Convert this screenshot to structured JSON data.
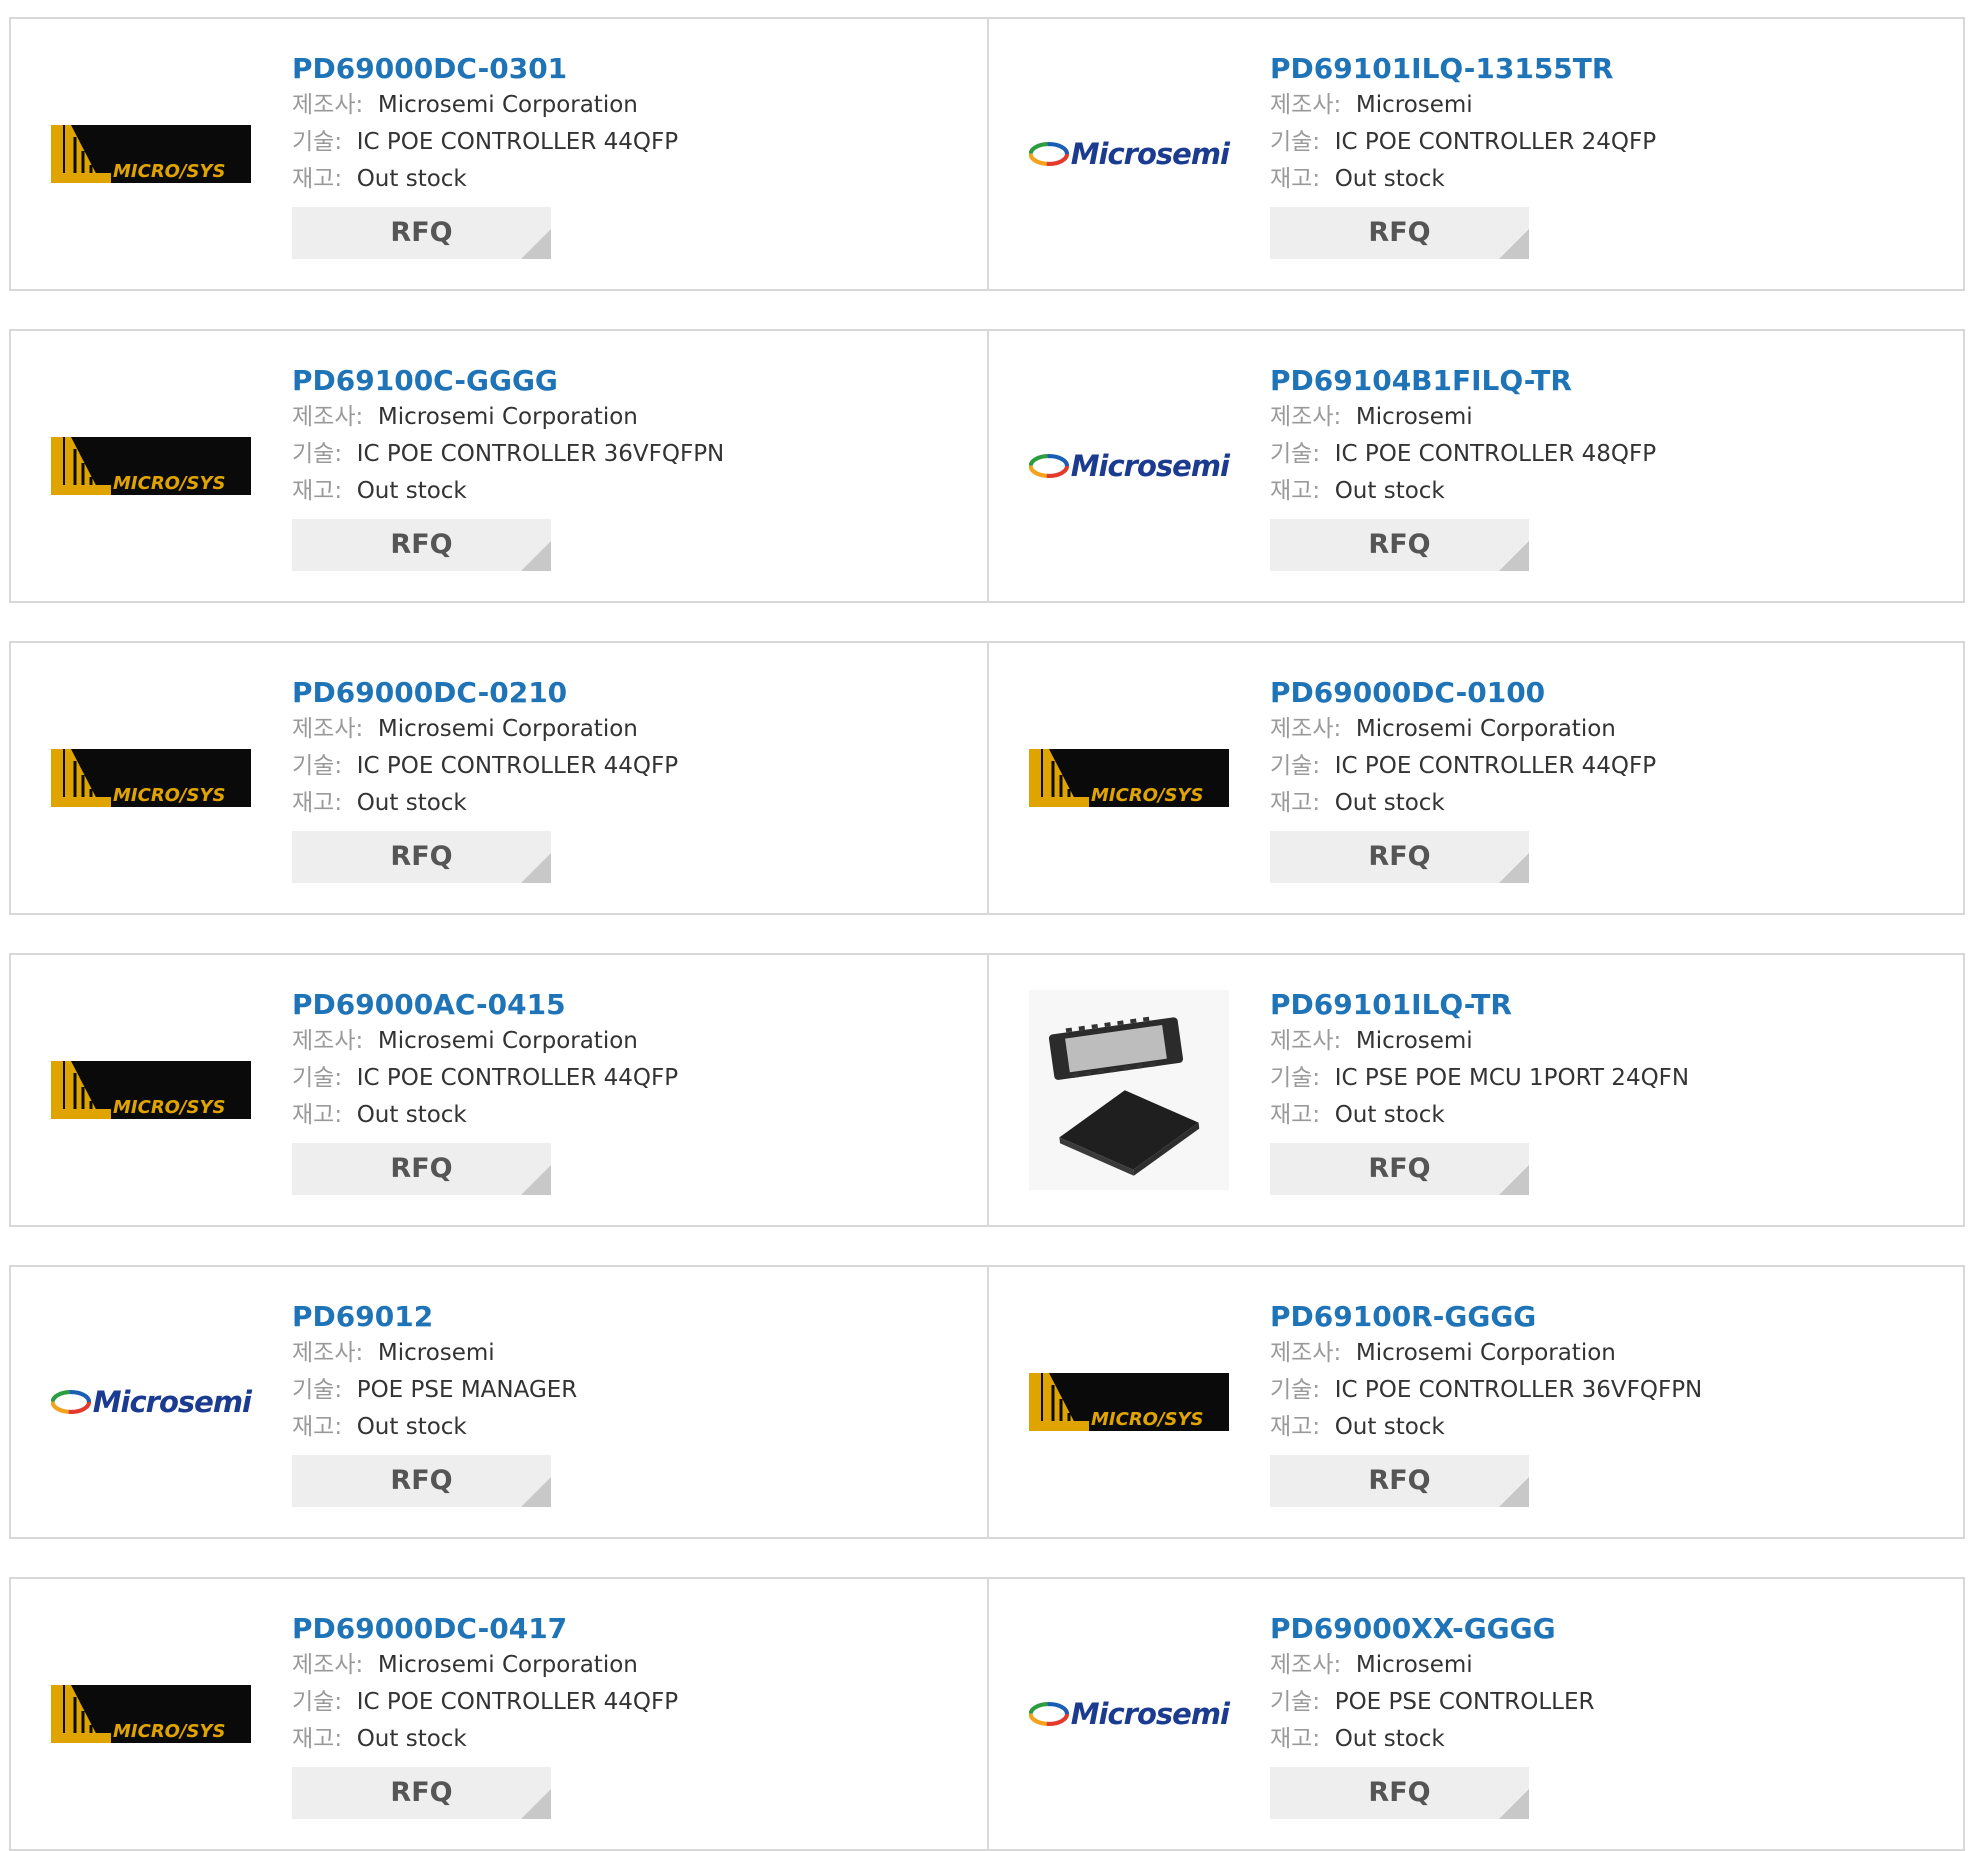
{
  "labels": {
    "manufacturer": "제조사:",
    "description": "기술:",
    "stock": "재고:",
    "rfq": "RFQ"
  },
  "logos": {
    "microsys_text": "MICRO/SYS",
    "microsemi_text": "Microsemi"
  },
  "colors": {
    "part_link": "#1f73b7",
    "label_gray": "#9a9a9a",
    "value_text": "#333333",
    "rfq_bg": "#eeeeee",
    "microsys_gold": "#e0a400"
  },
  "products": [
    {
      "part": "PD69000DC-0301",
      "manufacturer": "Microsemi Corporation",
      "description": "IC POE CONTROLLER 44QFP",
      "stock": "Out stock",
      "logo": "microsys"
    },
    {
      "part": "PD69101ILQ-13155TR",
      "manufacturer": "Microsemi",
      "description": "IC POE CONTROLLER 24QFP",
      "stock": "Out stock",
      "logo": "microsemi"
    },
    {
      "part": "PD69100C-GGGG",
      "manufacturer": "Microsemi Corporation",
      "description": "IC POE CONTROLLER 36VFQFPN",
      "stock": "Out stock",
      "logo": "microsys"
    },
    {
      "part": "PD69104B1FILQ-TR",
      "manufacturer": "Microsemi",
      "description": "IC POE CONTROLLER 48QFP",
      "stock": "Out stock",
      "logo": "microsemi"
    },
    {
      "part": "PD69000DC-0210",
      "manufacturer": "Microsemi Corporation",
      "description": "IC POE CONTROLLER 44QFP",
      "stock": "Out stock",
      "logo": "microsys"
    },
    {
      "part": "PD69000DC-0100",
      "manufacturer": "Microsemi Corporation",
      "description": "IC POE CONTROLLER 44QFP",
      "stock": "Out stock",
      "logo": "microsys"
    },
    {
      "part": "PD69000AC-0415",
      "manufacturer": "Microsemi Corporation",
      "description": "IC POE CONTROLLER 44QFP",
      "stock": "Out stock",
      "logo": "microsys"
    },
    {
      "part": "PD69101ILQ-TR",
      "manufacturer": "Microsemi",
      "description": "IC PSE POE MCU 1PORT 24QFN",
      "stock": "Out stock",
      "logo": "chip"
    },
    {
      "part": "PD69012",
      "manufacturer": "Microsemi",
      "description": "POE PSE MANAGER",
      "stock": "Out stock",
      "logo": "microsemi"
    },
    {
      "part": "PD69100R-GGGG",
      "manufacturer": "Microsemi Corporation",
      "description": "IC POE CONTROLLER 36VFQFPN",
      "stock": "Out stock",
      "logo": "microsys"
    },
    {
      "part": "PD69000DC-0417",
      "manufacturer": "Microsemi Corporation",
      "description": "IC POE CONTROLLER 44QFP",
      "stock": "Out stock",
      "logo": "microsys"
    },
    {
      "part": "PD69000XX-GGGG",
      "manufacturer": "Microsemi",
      "description": "POE PSE CONTROLLER",
      "stock": "Out stock",
      "logo": "microsemi"
    }
  ]
}
